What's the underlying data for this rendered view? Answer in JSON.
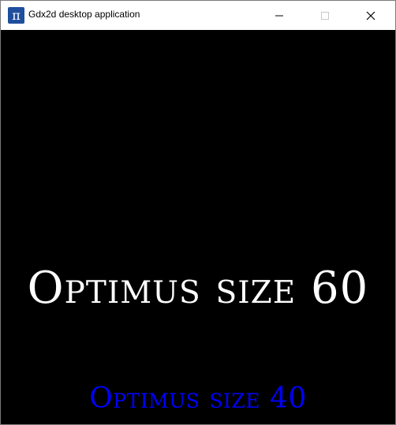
{
  "window": {
    "title": "Gdx2d desktop application",
    "icon_glyph": "π",
    "icon_color": "#1f4e9c"
  },
  "canvas": {
    "background": "#000000",
    "label_large": "Optimus size 60",
    "label_large_color": "#ffffff",
    "label_small": "Optimus size 40",
    "label_small_color": "#0000ff"
  }
}
